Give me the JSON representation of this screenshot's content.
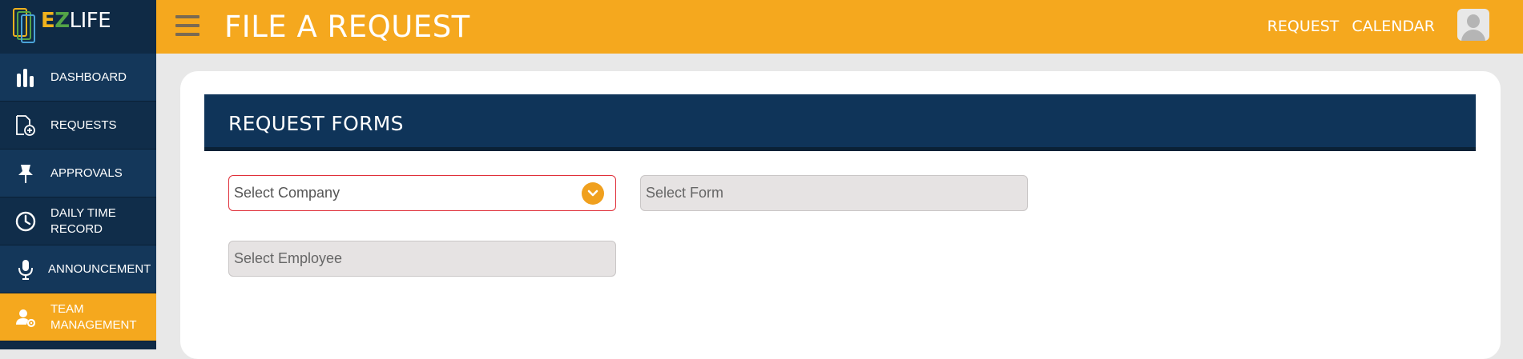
{
  "app": {
    "logo": {
      "e": "E",
      "z": "Z",
      "life": "LIFE"
    }
  },
  "header": {
    "title": "FILE A REQUEST",
    "links": [
      "REQUEST",
      "CALENDAR"
    ]
  },
  "sidebar": {
    "items": [
      {
        "label": "DASHBOARD",
        "icon": "bar-chart-icon"
      },
      {
        "label": "REQUESTS",
        "icon": "document-add-icon"
      },
      {
        "label": "APPROVALS",
        "icon": "pushpin-icon"
      },
      {
        "label": "DAILY TIME RECORD",
        "icon": "clock-icon"
      },
      {
        "label": "ANNOUNCEMENT",
        "icon": "microphone-icon"
      },
      {
        "label": "TEAM MANAGEMENT",
        "icon": "user-gear-icon",
        "active": true
      }
    ]
  },
  "main": {
    "section_title": "REQUEST FORMS",
    "fields": {
      "company": "Select Company",
      "form": "Select Form",
      "employee": "Select Employee"
    }
  },
  "colors": {
    "accent": "#f5a81e",
    "navy": "#0f3459",
    "sidebar": "#0f2a45",
    "error_border": "#e0303a"
  }
}
